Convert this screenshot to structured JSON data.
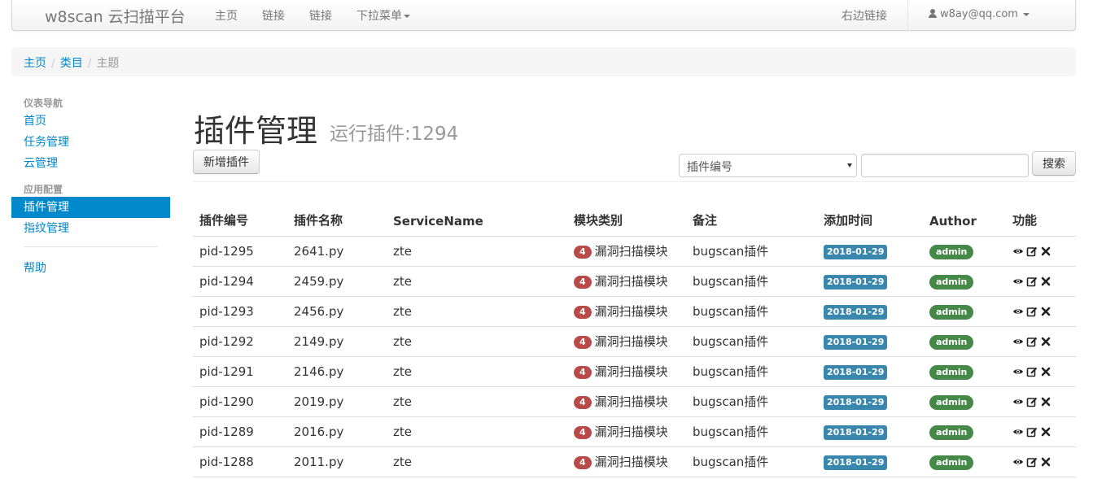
{
  "navbar": {
    "brand": "w8scan 云扫描平台",
    "links": [
      "主页",
      "链接",
      "链接"
    ],
    "dropdown": "下拉菜单",
    "right_link": "右边链接",
    "user": "w8ay@qq.com"
  },
  "breadcrumb": [
    "主页",
    "类目",
    "主题"
  ],
  "sidebar": {
    "header1": "仪表导航",
    "items1": [
      "首页",
      "任务管理",
      "云管理"
    ],
    "header2": "应用配置",
    "items2": [
      "插件管理",
      "指纹管理"
    ],
    "items3": [
      "帮助"
    ]
  },
  "page": {
    "title": "插件管理",
    "subtitle": "运行插件:1294",
    "add_button": "新增插件",
    "select_value": "插件编号",
    "search_button": "搜索"
  },
  "table": {
    "headers": [
      "插件编号",
      "插件名称",
      "ServiceName",
      "模块类别",
      "备注",
      "添加时间",
      "Author",
      "功能"
    ],
    "rows": [
      {
        "id": "pid-1295",
        "name": "2641.py",
        "service": "zte",
        "badge": "4",
        "category": "漏洞扫描模块",
        "note": "bugscan插件",
        "date": "2018-01-29",
        "author": "admin"
      },
      {
        "id": "pid-1294",
        "name": "2459.py",
        "service": "zte",
        "badge": "4",
        "category": "漏洞扫描模块",
        "note": "bugscan插件",
        "date": "2018-01-29",
        "author": "admin"
      },
      {
        "id": "pid-1293",
        "name": "2456.py",
        "service": "zte",
        "badge": "4",
        "category": "漏洞扫描模块",
        "note": "bugscan插件",
        "date": "2018-01-29",
        "author": "admin"
      },
      {
        "id": "pid-1292",
        "name": "2149.py",
        "service": "zte",
        "badge": "4",
        "category": "漏洞扫描模块",
        "note": "bugscan插件",
        "date": "2018-01-29",
        "author": "admin"
      },
      {
        "id": "pid-1291",
        "name": "2146.py",
        "service": "zte",
        "badge": "4",
        "category": "漏洞扫描模块",
        "note": "bugscan插件",
        "date": "2018-01-29",
        "author": "admin"
      },
      {
        "id": "pid-1290",
        "name": "2019.py",
        "service": "zte",
        "badge": "4",
        "category": "漏洞扫描模块",
        "note": "bugscan插件",
        "date": "2018-01-29",
        "author": "admin"
      },
      {
        "id": "pid-1289",
        "name": "2016.py",
        "service": "zte",
        "badge": "4",
        "category": "漏洞扫描模块",
        "note": "bugscan插件",
        "date": "2018-01-29",
        "author": "admin"
      },
      {
        "id": "pid-1288",
        "name": "2011.py",
        "service": "zte",
        "badge": "4",
        "category": "漏洞扫描模块",
        "note": "bugscan插件",
        "date": "2018-01-29",
        "author": "admin"
      }
    ],
    "actions": [
      "eye-icon",
      "edit-icon",
      "remove-icon"
    ]
  }
}
